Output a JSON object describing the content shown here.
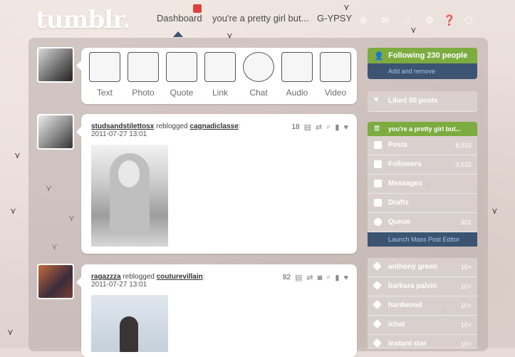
{
  "header": {
    "logo": "tumblr.",
    "nav": {
      "dashboard": "Dashboard",
      "blog": "you're a pretty girl but...",
      "user": "G-YPSY"
    }
  },
  "post_types": [
    {
      "label": "Text"
    },
    {
      "label": "Photo"
    },
    {
      "label": "Quote"
    },
    {
      "label": "Link"
    },
    {
      "label": "Chat"
    },
    {
      "label": "Audio"
    },
    {
      "label": "Video"
    }
  ],
  "posts": [
    {
      "author": "studsandstilettosx",
      "action": "reblogged",
      "source": "cagnadiclasse",
      "date": "2011-07-27 13:01",
      "notes": "18"
    },
    {
      "author": "ragazzza",
      "action": "reblogged",
      "source": "couturevillain",
      "date": "2011-07-27 13:01",
      "notes": "82"
    }
  ],
  "sidebar": {
    "following": "Following 230 people",
    "add_remove": "Add and remove",
    "liked": "Liked 90 posts",
    "blog_title": "you're a pretty girl but...",
    "blog_items": [
      {
        "label": "Posts",
        "count": "8,533"
      },
      {
        "label": "Followers",
        "count": "3,632"
      },
      {
        "label": "Messages",
        "count": ""
      },
      {
        "label": "Drafts",
        "count": ""
      },
      {
        "label": "Queue",
        "count": "301"
      }
    ],
    "mass_post": "Launch Mass Post Editor",
    "tags": [
      {
        "label": "anthony green",
        "count": "10+"
      },
      {
        "label": "barbara palvin",
        "count": "10+"
      },
      {
        "label": "hardwood",
        "count": "10+"
      },
      {
        "label": "ichat",
        "count": "10+"
      },
      {
        "label": "instant star",
        "count": "10+"
      }
    ]
  },
  "colors": {
    "sidebar_green": "#7cab3f",
    "sidebar_blue": "#3c5472",
    "badge_red": "#d9433d"
  }
}
